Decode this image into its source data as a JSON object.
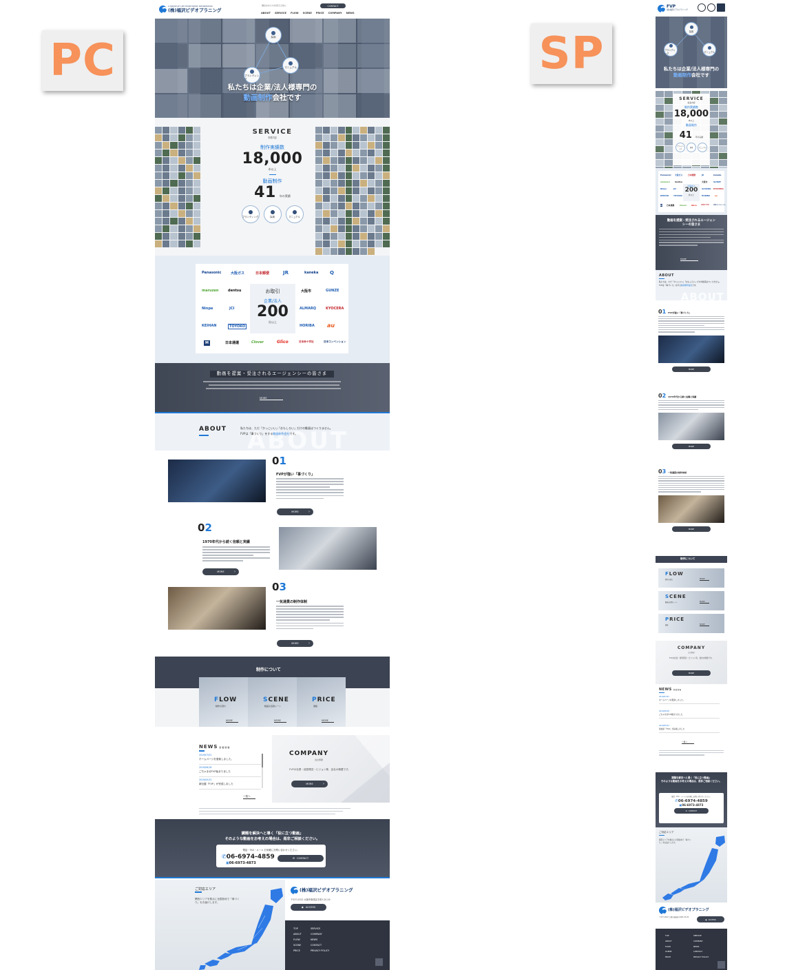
{
  "labels": {
    "pc": "PC",
    "sp": "SP"
  },
  "colors": {
    "accent": "#1e78d6",
    "dark": "#3c4452",
    "label_text": "#f6925a"
  },
  "header": {
    "logo_sub": "A HOUSE OF LIFE FROM FAMILY INFORMATION",
    "logo_text": "(株)福沢ビデオプラニング",
    "sp_logo_text": "FVP",
    "sp_logo_sub": "(株)福沢ビデオプラニング",
    "tagline": "御社のかたちを見える化に",
    "contact": "CONTACT",
    "nav": [
      "ABOUT",
      "SERVICE",
      "FLOW",
      "SCENE",
      "PRICE",
      "COMPANY",
      "NEWS"
    ]
  },
  "hero": {
    "circles": [
      {
        "label": "採用",
        "icon": "person-icon"
      },
      {
        "label": "ブランディング",
        "icon": "star-icon"
      },
      {
        "label": "マニュアル",
        "icon": "book-icon"
      }
    ],
    "title_a": "私たちは企業/法人様専門の",
    "title_b": "動画制作",
    "title_c": "会社です"
  },
  "service": {
    "heading": "SERVICE",
    "sub": "事業内容",
    "count_label_a": "制作",
    "count_label_b": "実績数",
    "count": "18,000",
    "count_unit": "本以上",
    "years_label_a": "動画",
    "years_label_b": "制作",
    "years": "41",
    "years_unit": "年の実績",
    "circles": [
      "ブランディング",
      "採用",
      "マニュアル"
    ]
  },
  "clients": {
    "logos": [
      "Panasonic",
      "大阪ガス",
      "日本郵便",
      "JR",
      "kaneka",
      "Q",
      "maruzen",
      "dentsu",
      "大阪市",
      "GUNZE",
      "Ninpe",
      "JCI",
      "ALMARQ",
      "KYOCERA",
      "KEIHAN",
      "TOYOKO",
      "HORIBA",
      "au",
      "M",
      "日本通運",
      "Clover",
      "Glico",
      "日本赤十字社",
      "日本コンベンション"
    ],
    "center_a": "お取引",
    "center_b": "企業/法人",
    "center_count": "200",
    "center_unit": "社以上"
  },
  "agency": {
    "title": "動画を提案・受注されるエージェンシーの皆さま",
    "more": "MORE",
    "sp_title_a": "動画を提案・受注されるエージェン",
    "sp_title_b": "シーの皆さま"
  },
  "about": {
    "heading": "ABOUT",
    "bg": "ABOUT",
    "text_a": "私たちは、ただ「かっこいい」「おもしろい」だけの動画はつくりません。",
    "text_b_pre": "FVPは「事づくり」をする",
    "text_b_hl": "動画制作会社",
    "text_b_post": "です。"
  },
  "features": [
    {
      "num_a": "0",
      "num_b": "1",
      "title": "FVPが強い「事づくり」",
      "more": "MORE"
    },
    {
      "num_a": "0",
      "num_b": "2",
      "title": "1970年代から続く信頼と実績",
      "more": "MORE"
    },
    {
      "num_a": "0",
      "num_b": "3",
      "title": "一気通貫の制作体制",
      "more": "MORE"
    }
  ],
  "making": {
    "title": "制作について",
    "cards": [
      {
        "first": "F",
        "rest": "LOW",
        "sub": "制作の流れ",
        "more": "MORE"
      },
      {
        "first": "S",
        "rest": "CENE",
        "sub": "動画の活用シーン",
        "more": "MORE"
      },
      {
        "first": "P",
        "rest": "RICE",
        "sub": "価格",
        "more": "MORE"
      }
    ]
  },
  "news": {
    "heading": "NEWS",
    "sub": "新着情報",
    "items": [
      {
        "date": "2019/07/01",
        "title": "ホームページを更新しました。"
      },
      {
        "date": "2019/06/18",
        "title": "ごちゃまぜFVP始まりました"
      },
      {
        "date": "2019/05/31",
        "title": "新社屋「FVP」が完成しました"
      }
    ],
    "link": "一覧へ"
  },
  "company": {
    "heading": "COMPANY",
    "sub": "会社概要",
    "text": "FVPの社是・経営理念・ビジョン等、会社の概要です。",
    "more": "MORE"
  },
  "cta": {
    "line1": "課題を解決へと導く「役に立つ動画」",
    "line2": "そのような動画をお考えの場合は、是非ご相談ください。",
    "note": "電話・FAX・メール お気軽にお問い合わせください。",
    "tel": "06-6974-4859",
    "fax": "06-6973-4873",
    "contact": "CONTACT"
  },
  "area": {
    "heading": "ご対応エリア",
    "text": "関西エリアを拠点に全国各地で「事づくり」をお届けします。"
  },
  "footer": {
    "address": "〒537-0022 大阪市東成区中本5-20-26",
    "access": "ACCESS",
    "col1": [
      "TOP",
      "ABOUT",
      "FLOW",
      "SCENE",
      "PRICE"
    ],
    "col2": [
      "SERVICE",
      "COMPANY",
      "NEWS",
      "CONTACT",
      "PRIVACY POLICY"
    ]
  }
}
